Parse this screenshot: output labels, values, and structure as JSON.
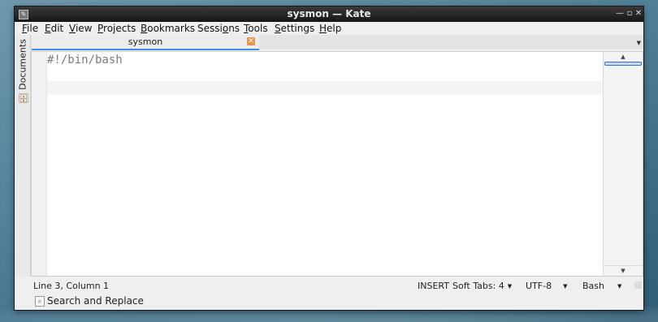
{
  "window": {
    "title": "sysmon  — Kate"
  },
  "menubar": {
    "items": [
      {
        "label": "File",
        "u": "F",
        "rest": "ile"
      },
      {
        "label": "Edit",
        "u": "E",
        "rest": "dit"
      },
      {
        "label": "View",
        "u": "V",
        "rest": "iew"
      },
      {
        "label": "Projects",
        "u": "P",
        "rest": "rojects"
      },
      {
        "label": "Bookmarks",
        "u": "B",
        "rest": "ookmarks"
      },
      {
        "label": "Sessions",
        "pre": "Sessi",
        "u": "o",
        "rest": "ns"
      },
      {
        "label": "Tools",
        "u": "T",
        "rest": "ools"
      },
      {
        "label": "Settings",
        "u": "S",
        "rest": "ettings"
      },
      {
        "label": "Help",
        "u": "H",
        "rest": "elp"
      }
    ]
  },
  "sidebar": {
    "tab_label": "Documents"
  },
  "tabs": {
    "active_label": "sysmon"
  },
  "editor": {
    "lines": [
      "#!/bin/bash",
      "",
      ""
    ]
  },
  "status": {
    "position": "Line 3, Column 1",
    "mode": "INSERT",
    "indent": "Soft Tabs: 4",
    "encoding": "UTF-8",
    "syntax": "Bash"
  },
  "bottom": {
    "search_replace": "Search and Replace"
  },
  "colors": {
    "tab_underline": "#3d8ee8",
    "close_badge": "#e8944a"
  }
}
